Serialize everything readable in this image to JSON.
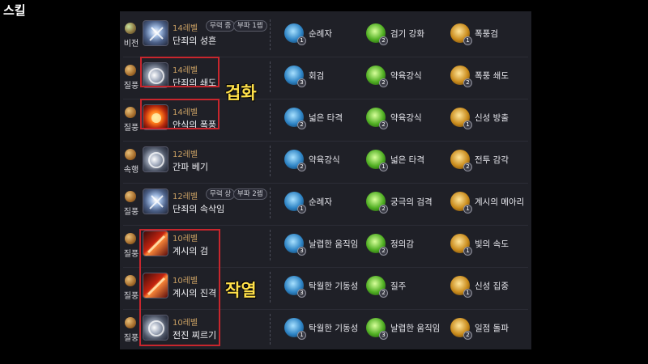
{
  "header": {
    "title": "스킬"
  },
  "skills": [
    {
      "gem": "비전",
      "level": "14레벨",
      "name": "단죄의 성흔",
      "tags": [
        "무력 중",
        "부파 1렙"
      ],
      "icon": "blue",
      "tripods": [
        {
          "label": "순례자",
          "tier": "1",
          "color": "blue"
        },
        {
          "label": "검기 강화",
          "tier": "2",
          "color": "green"
        },
        {
          "label": "폭풍검",
          "tier": "1",
          "color": "gold"
        }
      ]
    },
    {
      "gem": "질풍",
      "level": "14레벨",
      "name": "단죄의 쇄도",
      "tags": [],
      "icon": "silver",
      "tripods": [
        {
          "label": "회검",
          "tier": "3",
          "color": "blue"
        },
        {
          "label": "약육강식",
          "tier": "2",
          "color": "green"
        },
        {
          "label": "폭풍 쇄도",
          "tier": "2",
          "color": "gold"
        }
      ]
    },
    {
      "gem": "질풍",
      "level": "14레벨",
      "name": "안식의 폭풍",
      "tags": [],
      "icon": "fire",
      "tripods": [
        {
          "label": "넓은 타격",
          "tier": "2",
          "color": "blue"
        },
        {
          "label": "약육강식",
          "tier": "2",
          "color": "green"
        },
        {
          "label": "신성 방출",
          "tier": "1",
          "color": "gold"
        }
      ]
    },
    {
      "gem": "속행",
      "level": "12레벨",
      "name": "간파 베기",
      "tags": [],
      "icon": "silver",
      "tripods": [
        {
          "label": "약육강식",
          "tier": "2",
          "color": "blue"
        },
        {
          "label": "넓은 타격",
          "tier": "1",
          "color": "green"
        },
        {
          "label": "전투 감각",
          "tier": "2",
          "color": "gold"
        }
      ]
    },
    {
      "gem": "질풍",
      "level": "12레벨",
      "name": "단죄의 속삭임",
      "tags": [
        "무력 상",
        "부파 2렙"
      ],
      "icon": "blue",
      "tripods": [
        {
          "label": "순례자",
          "tier": "1",
          "color": "blue"
        },
        {
          "label": "궁극의 검격",
          "tier": "2",
          "color": "green"
        },
        {
          "label": "계시의 메아리",
          "tier": "1",
          "color": "gold"
        }
      ]
    },
    {
      "gem": "질풍",
      "level": "10레벨",
      "name": "계시의 검",
      "tags": [],
      "icon": "red",
      "tripods": [
        {
          "label": "날렵한 움직임",
          "tier": "3",
          "color": "blue"
        },
        {
          "label": "정의감",
          "tier": "2",
          "color": "green"
        },
        {
          "label": "빛의 속도",
          "tier": "1",
          "color": "gold"
        }
      ]
    },
    {
      "gem": "질풍",
      "level": "10레벨",
      "name": "계시의 진격",
      "tags": [],
      "icon": "red",
      "tripods": [
        {
          "label": "탁월한 기동성",
          "tier": "3",
          "color": "blue"
        },
        {
          "label": "질주",
          "tier": "2",
          "color": "green"
        },
        {
          "label": "신성 집중",
          "tier": "1",
          "color": "gold"
        }
      ]
    },
    {
      "gem": "질풍",
      "level": "10레벨",
      "name": "전진 찌르기",
      "tags": [],
      "icon": "silver",
      "tripods": [
        {
          "label": "탁월한 기동성",
          "tier": "1",
          "color": "blue"
        },
        {
          "label": "날렵한 움직임",
          "tier": "3",
          "color": "green"
        },
        {
          "label": "일점 돌파",
          "tier": "2",
          "color": "gold"
        }
      ]
    }
  ],
  "callouts": {
    "first": "겁화",
    "second": "작열"
  }
}
